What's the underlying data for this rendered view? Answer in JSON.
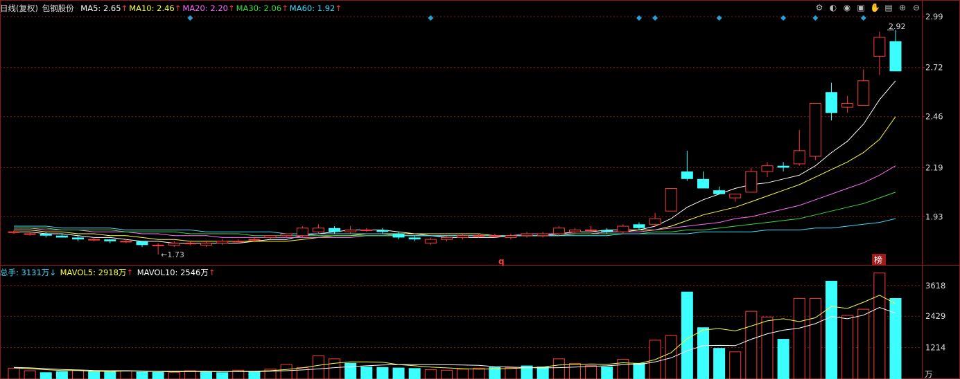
{
  "header": {
    "period": "日线(复权)",
    "stock_name": "包钢股份",
    "ma": [
      {
        "label": "MA5: ",
        "value": "2.65",
        "color": "#ffffff"
      },
      {
        "label": "MA10: ",
        "value": "2.46",
        "color": "#ffff3b"
      },
      {
        "label": "MA20: ",
        "value": "2.20",
        "color": "#ff6cff"
      },
      {
        "label": "MA30: ",
        "value": "2.06",
        "color": "#3bdc3b"
      },
      {
        "label": "MA60: ",
        "value": "1.92",
        "color": "#3bdcff"
      }
    ],
    "up_arrow": "↑",
    "down_arrow": "↓"
  },
  "volume_header": {
    "total": {
      "label": "总手: ",
      "value": "3131万",
      "color": "#3bdcff"
    },
    "mavol5": {
      "label": "MAVOL5: ",
      "value": "2918万",
      "color": "#ffff3b"
    },
    "mavol10": {
      "label": "MAVOL10: ",
      "value": "2546万",
      "color": "#ffffff"
    }
  },
  "markers": {
    "low_label": "1.73",
    "high_label": "2.92",
    "q_label": "q",
    "bang_label": "榜",
    "vol_unit": "万"
  },
  "toolbar": [
    "gear-icon",
    "contrast-icon",
    "eye-icon",
    "briefcase-icon",
    "hand-icon",
    "lock-icon",
    "zoom-in-icon",
    "zoom-out-icon"
  ],
  "colors": {
    "up": "#ff3b3b",
    "down": "#3bffff",
    "grid": "#8a1a1a",
    "axis_text": "#dddddd"
  },
  "chart_data": [
    {
      "type": "candlestick",
      "title": "",
      "ylim": [
        1.73,
        2.99
      ],
      "yticks": [
        2.99,
        2.72,
        2.46,
        2.19,
        1.93
      ],
      "grid": true,
      "ohlc": [
        [
          1.85,
          1.86,
          1.84,
          1.85
        ],
        [
          1.84,
          1.85,
          1.83,
          1.84
        ],
        [
          1.84,
          1.85,
          1.82,
          1.83
        ],
        [
          1.83,
          1.84,
          1.82,
          1.82
        ],
        [
          1.82,
          1.83,
          1.8,
          1.81
        ],
        [
          1.81,
          1.82,
          1.8,
          1.81
        ],
        [
          1.81,
          1.81,
          1.79,
          1.8
        ],
        [
          1.8,
          1.81,
          1.79,
          1.8
        ],
        [
          1.8,
          1.8,
          1.77,
          1.78
        ],
        [
          1.78,
          1.79,
          1.73,
          1.78
        ],
        [
          1.78,
          1.8,
          1.77,
          1.79
        ],
        [
          1.79,
          1.8,
          1.78,
          1.79
        ],
        [
          1.78,
          1.8,
          1.77,
          1.79
        ],
        [
          1.79,
          1.81,
          1.78,
          1.8
        ],
        [
          1.8,
          1.81,
          1.79,
          1.8
        ],
        [
          1.81,
          1.82,
          1.8,
          1.81
        ],
        [
          1.82,
          1.83,
          1.81,
          1.83
        ],
        [
          1.83,
          1.84,
          1.82,
          1.84
        ],
        [
          1.83,
          1.88,
          1.82,
          1.87
        ],
        [
          1.85,
          1.89,
          1.84,
          1.87
        ],
        [
          1.87,
          1.88,
          1.84,
          1.85
        ],
        [
          1.85,
          1.88,
          1.84,
          1.86
        ],
        [
          1.86,
          1.87,
          1.85,
          1.86
        ],
        [
          1.86,
          1.87,
          1.84,
          1.85
        ],
        [
          1.84,
          1.85,
          1.81,
          1.82
        ],
        [
          1.82,
          1.83,
          1.8,
          1.81
        ],
        [
          1.79,
          1.82,
          1.78,
          1.81
        ],
        [
          1.81,
          1.83,
          1.8,
          1.82
        ],
        [
          1.82,
          1.84,
          1.81,
          1.83
        ],
        [
          1.83,
          1.84,
          1.82,
          1.83
        ],
        [
          1.83,
          1.84,
          1.82,
          1.83
        ],
        [
          1.82,
          1.84,
          1.81,
          1.83
        ],
        [
          1.83,
          1.85,
          1.82,
          1.84
        ],
        [
          1.83,
          1.85,
          1.82,
          1.84
        ],
        [
          1.84,
          1.88,
          1.83,
          1.87
        ],
        [
          1.85,
          1.87,
          1.84,
          1.86
        ],
        [
          1.86,
          1.88,
          1.85,
          1.86
        ],
        [
          1.86,
          1.87,
          1.84,
          1.85
        ],
        [
          1.85,
          1.89,
          1.84,
          1.88
        ],
        [
          1.89,
          1.9,
          1.86,
          1.87
        ],
        [
          1.89,
          1.95,
          1.88,
          1.92
        ],
        [
          1.96,
          2.08,
          1.96,
          2.08
        ],
        [
          2.17,
          2.28,
          2.12,
          2.13
        ],
        [
          2.13,
          2.17,
          2.08,
          2.08
        ],
        [
          2.07,
          2.09,
          2.05,
          2.05
        ],
        [
          2.03,
          2.05,
          2.01,
          2.05
        ],
        [
          2.06,
          2.19,
          2.06,
          2.17
        ],
        [
          2.17,
          2.22,
          2.14,
          2.2
        ],
        [
          2.2,
          2.22,
          2.17,
          2.19
        ],
        [
          2.21,
          2.39,
          2.2,
          2.28
        ],
        [
          2.25,
          2.53,
          2.23,
          2.53
        ],
        [
          2.59,
          2.64,
          2.44,
          2.48
        ],
        [
          2.51,
          2.57,
          2.48,
          2.53
        ],
        [
          2.52,
          2.71,
          2.52,
          2.65
        ],
        [
          2.78,
          2.91,
          2.68,
          2.88
        ],
        [
          2.86,
          2.92,
          2.7,
          2.7
        ]
      ],
      "ma": [
        {
          "name": "MA5",
          "color": "#ffffff",
          "values": [
            1.85,
            1.85,
            1.84,
            1.84,
            1.83,
            1.82,
            1.82,
            1.81,
            1.8,
            1.8,
            1.79,
            1.79,
            1.79,
            1.79,
            1.79,
            1.8,
            1.81,
            1.81,
            1.83,
            1.84,
            1.85,
            1.86,
            1.86,
            1.86,
            1.85,
            1.84,
            1.83,
            1.82,
            1.82,
            1.82,
            1.82,
            1.83,
            1.83,
            1.83,
            1.84,
            1.85,
            1.85,
            1.86,
            1.86,
            1.86,
            1.88,
            1.92,
            1.98,
            2.02,
            2.05,
            2.08,
            2.1,
            2.11,
            2.13,
            2.15,
            2.2,
            2.27,
            2.33,
            2.42,
            2.55,
            2.65
          ]
        },
        {
          "name": "MA10",
          "color": "#ffff3b",
          "values": [
            1.86,
            1.86,
            1.85,
            1.85,
            1.84,
            1.84,
            1.83,
            1.83,
            1.82,
            1.81,
            1.81,
            1.8,
            1.8,
            1.8,
            1.8,
            1.8,
            1.8,
            1.8,
            1.81,
            1.82,
            1.83,
            1.83,
            1.84,
            1.84,
            1.84,
            1.84,
            1.84,
            1.84,
            1.84,
            1.84,
            1.83,
            1.83,
            1.83,
            1.83,
            1.83,
            1.84,
            1.84,
            1.85,
            1.85,
            1.86,
            1.86,
            1.88,
            1.91,
            1.94,
            1.96,
            1.98,
            2.01,
            2.04,
            2.07,
            2.1,
            2.14,
            2.18,
            2.22,
            2.27,
            2.34,
            2.46
          ]
        },
        {
          "name": "MA20",
          "color": "#ff6cff",
          "values": [
            1.87,
            1.87,
            1.86,
            1.86,
            1.86,
            1.85,
            1.85,
            1.85,
            1.84,
            1.84,
            1.83,
            1.83,
            1.83,
            1.82,
            1.82,
            1.82,
            1.82,
            1.82,
            1.82,
            1.82,
            1.82,
            1.82,
            1.83,
            1.83,
            1.83,
            1.83,
            1.83,
            1.83,
            1.83,
            1.83,
            1.83,
            1.83,
            1.84,
            1.84,
            1.84,
            1.84,
            1.84,
            1.85,
            1.85,
            1.85,
            1.86,
            1.87,
            1.88,
            1.89,
            1.9,
            1.92,
            1.93,
            1.95,
            1.97,
            1.99,
            2.02,
            2.05,
            2.08,
            2.11,
            2.15,
            2.2
          ]
        },
        {
          "name": "MA30",
          "color": "#3bdc3b",
          "values": [
            1.87,
            1.87,
            1.87,
            1.86,
            1.86,
            1.86,
            1.86,
            1.85,
            1.85,
            1.85,
            1.85,
            1.84,
            1.84,
            1.84,
            1.84,
            1.83,
            1.83,
            1.83,
            1.83,
            1.83,
            1.83,
            1.83,
            1.83,
            1.83,
            1.83,
            1.83,
            1.83,
            1.83,
            1.83,
            1.83,
            1.83,
            1.83,
            1.83,
            1.83,
            1.83,
            1.84,
            1.84,
            1.84,
            1.84,
            1.84,
            1.85,
            1.85,
            1.86,
            1.86,
            1.87,
            1.88,
            1.89,
            1.9,
            1.91,
            1.92,
            1.94,
            1.96,
            1.98,
            2.0,
            2.03,
            2.06
          ]
        },
        {
          "name": "MA60",
          "color": "#3bdcff",
          "values": [
            1.88,
            1.88,
            1.88,
            1.87,
            1.87,
            1.87,
            1.87,
            1.86,
            1.86,
            1.86,
            1.86,
            1.86,
            1.85,
            1.85,
            1.85,
            1.85,
            1.85,
            1.84,
            1.84,
            1.84,
            1.84,
            1.84,
            1.84,
            1.84,
            1.83,
            1.83,
            1.83,
            1.83,
            1.83,
            1.83,
            1.83,
            1.83,
            1.83,
            1.83,
            1.83,
            1.83,
            1.83,
            1.83,
            1.84,
            1.84,
            1.84,
            1.84,
            1.84,
            1.85,
            1.85,
            1.85,
            1.85,
            1.86,
            1.86,
            1.86,
            1.87,
            1.87,
            1.88,
            1.89,
            1.9,
            1.92
          ]
        }
      ],
      "event_markers": [
        11,
        26,
        39,
        40,
        44,
        48,
        50,
        53
      ]
    },
    {
      "type": "bar",
      "title": "",
      "ylim": [
        0,
        3800
      ],
      "yticks": [
        3618,
        2429,
        1214
      ],
      "yunit": "万",
      "values": [
        420,
        320,
        260,
        300,
        340,
        300,
        290,
        310,
        280,
        270,
        260,
        320,
        290,
        260,
        340,
        310,
        380,
        560,
        440,
        900,
        780,
        620,
        480,
        460,
        440,
        420,
        360,
        340,
        380,
        420,
        460,
        440,
        520,
        480,
        780,
        600,
        520,
        480,
        760,
        620,
        1500,
        1680,
        3380,
        2000,
        1200,
        1050,
        2620,
        2400,
        1550,
        3120,
        3120,
        3800,
        2460,
        2700,
        4100,
        3131
      ],
      "up": [
        1,
        1,
        0,
        0,
        1,
        0,
        0,
        1,
        0,
        0,
        1,
        1,
        0,
        0,
        1,
        0,
        1,
        1,
        1,
        1,
        1,
        0,
        0,
        0,
        0,
        0,
        1,
        1,
        1,
        1,
        0,
        1,
        0,
        0,
        1,
        1,
        1,
        0,
        1,
        0,
        1,
        1,
        0,
        0,
        0,
        1,
        1,
        1,
        0,
        1,
        1,
        0,
        1,
        1,
        1,
        0
      ],
      "mavol": [
        {
          "name": "MAVOL5",
          "color": "#ffff3b",
          "values": [
            430,
            400,
            360,
            330,
            330,
            300,
            290,
            310,
            300,
            290,
            280,
            290,
            290,
            280,
            300,
            300,
            320,
            370,
            430,
            530,
            610,
            660,
            660,
            650,
            560,
            510,
            460,
            430,
            400,
            380,
            390,
            410,
            430,
            460,
            540,
            560,
            580,
            570,
            630,
            600,
            750,
            1020,
            1560,
            1900,
            1950,
            1860,
            2050,
            2250,
            2330,
            2220,
            2370,
            2810,
            2730,
            2970,
            3240,
            2918
          ]
        },
        {
          "name": "MAVOL10",
          "color": "#ffffff",
          "values": [
            450,
            430,
            400,
            370,
            350,
            330,
            320,
            320,
            310,
            300,
            300,
            300,
            300,
            290,
            290,
            290,
            300,
            320,
            350,
            390,
            440,
            480,
            510,
            540,
            560,
            560,
            560,
            550,
            540,
            530,
            480,
            460,
            440,
            430,
            440,
            460,
            490,
            510,
            550,
            560,
            660,
            820,
            1090,
            1290,
            1300,
            1290,
            1540,
            1750,
            1890,
            1970,
            2140,
            2420,
            2330,
            2470,
            2770,
            2546
          ]
        }
      ]
    }
  ]
}
